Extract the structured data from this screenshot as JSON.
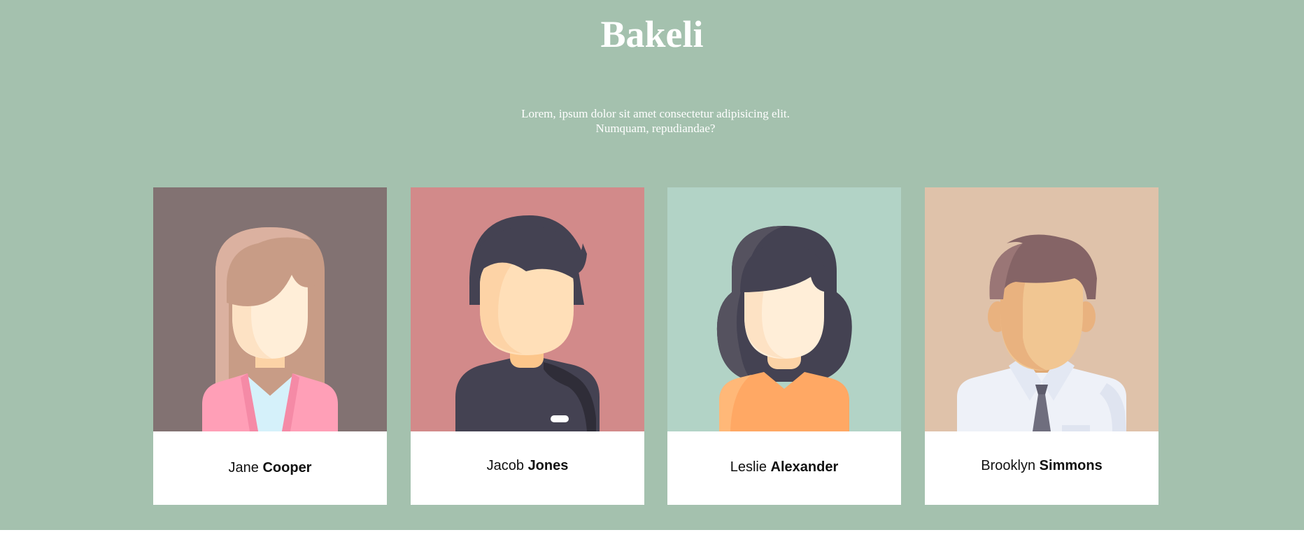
{
  "header": {
    "title": "Bakeli",
    "subtitle": "Lorem, ipsum dolor sit amet consectetur adipisicing elit. Numquam, repudiandae?"
  },
  "team": [
    {
      "first_name": "Jane",
      "last_name": "Cooper",
      "avatar_icon": "woman-avatar-icon"
    },
    {
      "first_name": "Jacob",
      "last_name": "Jones",
      "avatar_icon": "man-avatar-icon"
    },
    {
      "first_name": "Leslie",
      "last_name": "Alexander",
      "avatar_icon": "woman-avatar-icon"
    },
    {
      "first_name": "Brooklyn",
      "last_name": "Simmons",
      "avatar_icon": "man-avatar-icon"
    }
  ],
  "colors": {
    "page_background": "#a4c1ae",
    "card_background": "#ffffff",
    "portrait_backgrounds": [
      "#827272",
      "#d28a8a",
      "#b2d3c6",
      "#dfc2aa"
    ]
  }
}
